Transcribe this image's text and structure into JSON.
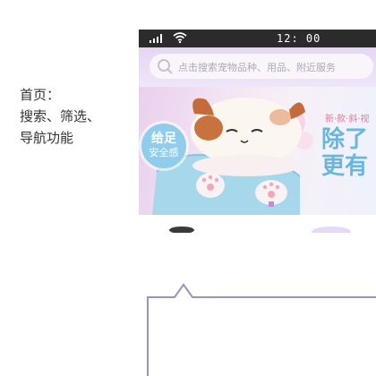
{
  "annotation": {
    "lines": [
      "首页：",
      "搜索、筛选、",
      "导航功能"
    ]
  },
  "statusbar": {
    "time": "12: 00",
    "icons": [
      "signal-icon",
      "wifi-icon"
    ]
  },
  "search": {
    "placeholder": "点击搜索宠物品种、用品、附近服务",
    "icon": "search-icon"
  },
  "banner": {
    "badge_line1": "给足",
    "badge_line2": "安全感",
    "tagline": "新·款·斜·视",
    "headline_line1": "除了",
    "headline_line2": "更有"
  },
  "colors": {
    "search_bg": "#e5d6f5",
    "statusbar_bg": "#2b2b2b",
    "badge": "#8fcdea",
    "headline": "#67b7df",
    "tagline": "#e17aa0",
    "callout_border": "#9a94bd"
  }
}
